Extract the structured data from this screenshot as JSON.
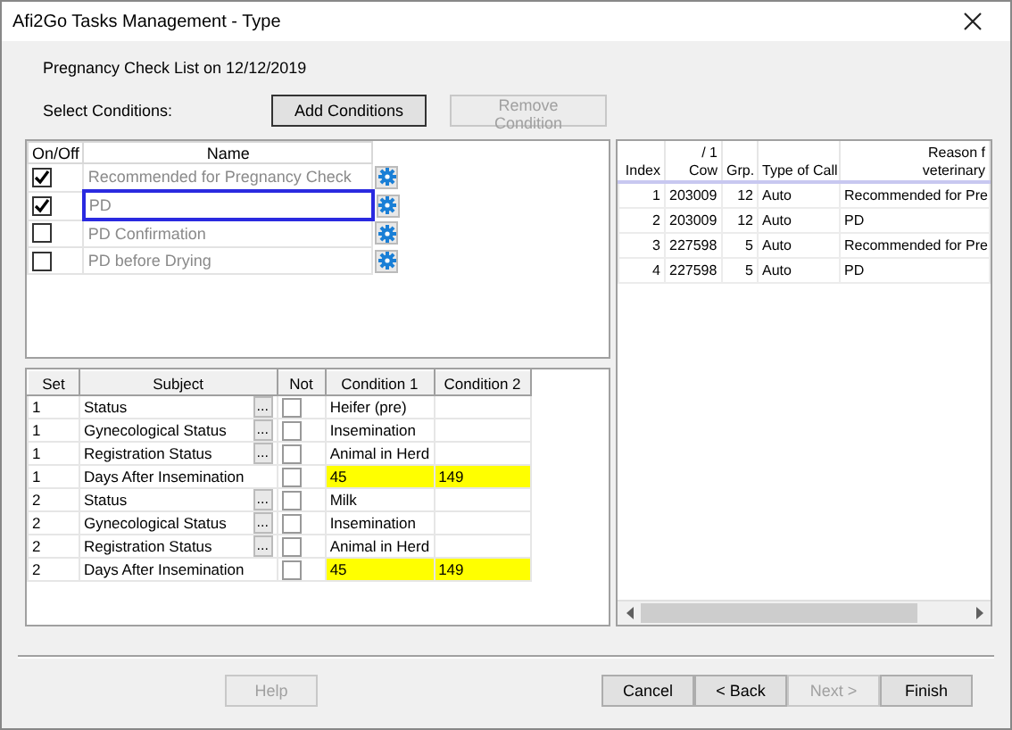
{
  "window": {
    "title": "Afi2Go Tasks Management - Type"
  },
  "heading": "Pregnancy Check List on 12/12/2019",
  "select_label": "Select Conditions:",
  "top_buttons": [
    {
      "label": "Add Conditions",
      "disabled": false
    },
    {
      "label": "Remove Condition",
      "disabled": true
    }
  ],
  "conditions": {
    "columns": [
      "On/Off",
      "Name"
    ],
    "items": [
      {
        "name": "Recommended for Pregnancy Check",
        "checked": true,
        "selected": false
      },
      {
        "name": "PD",
        "checked": true,
        "selected": true
      },
      {
        "name": "PD Confirmation",
        "checked": false,
        "selected": false
      },
      {
        "name": "PD before Drying",
        "checked": false,
        "selected": false
      }
    ]
  },
  "rules": {
    "columns": [
      "Set",
      "Subject",
      "Not",
      "Condition 1",
      "Condition 2"
    ],
    "rows": [
      {
        "set": "1",
        "subject": "Status",
        "picker": "...",
        "not": false,
        "condition_1": "Heifer (pre)",
        "highlighted": false
      },
      {
        "set": "1",
        "subject": "Gynecological Status",
        "picker": "...",
        "not": false,
        "condition_1": "Insemination",
        "highlighted": false
      },
      {
        "set": "1",
        "subject": "Registration Status",
        "picker": "...",
        "not": false,
        "condition_1": "Animal in Herd",
        "highlighted": false
      },
      {
        "set": "1",
        "subject": "Days After Insemination",
        "not": false,
        "condition_1": "45",
        "condition_2": "149",
        "highlighted": true
      },
      {
        "set": "2",
        "subject": "Status",
        "picker": "...",
        "not": false,
        "condition_1": "Milk",
        "highlighted": false
      },
      {
        "set": "2",
        "subject": "Gynecological Status",
        "picker": "...",
        "not": false,
        "condition_1": "Insemination",
        "highlighted": false
      },
      {
        "set": "2",
        "subject": "Registration Status",
        "picker": "...",
        "not": false,
        "condition_1": "Animal in Herd",
        "highlighted": false
      },
      {
        "set": "2",
        "subject": "Days After Insemination",
        "not": false,
        "condition_1": "45",
        "condition_2": "149",
        "highlighted": true
      }
    ]
  },
  "results": {
    "columns": [
      {
        "lines": [
          "Index"
        ]
      },
      {
        "lines": [
          "/ 1",
          "Cow"
        ]
      },
      {
        "lines": [
          "Grp."
        ]
      },
      {
        "lines": [
          "Type of Call"
        ]
      },
      {
        "lines": [
          "Reason f",
          "veterinary"
        ]
      }
    ],
    "rows": [
      [
        "1",
        "203009",
        "12",
        "Auto",
        "Recommended for Pre"
      ],
      [
        "2",
        "203009",
        "12",
        "Auto",
        "PD"
      ],
      [
        "3",
        "227598",
        "5",
        "Auto",
        "Recommended for Pre"
      ],
      [
        "4",
        "227598",
        "5",
        "Auto",
        "PD"
      ]
    ]
  },
  "footer_buttons": [
    {
      "label": "Help",
      "disabled": true
    },
    {
      "label": "Cancel",
      "disabled": false
    },
    {
      "label": "< Back",
      "disabled": false
    },
    {
      "label": "Next >",
      "disabled": true
    },
    {
      "label": "Finish",
      "disabled": false
    }
  ]
}
